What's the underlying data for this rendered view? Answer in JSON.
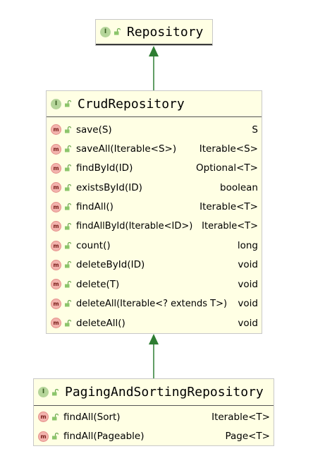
{
  "colors": {
    "box_fill": "#ffffe4",
    "box_border": "#c8c8c8",
    "arrow": "#2e7d32",
    "interface_badge": "#b5d59a",
    "method_badge": "#f2b3ad"
  },
  "badges": {
    "interface": "I",
    "method": "m"
  },
  "icons": {
    "visibility": "open-lock-icon"
  },
  "repository": {
    "name": "Repository"
  },
  "crud_repository": {
    "name": "CrudRepository",
    "methods": [
      {
        "name": "save(S)",
        "return_type": "S"
      },
      {
        "name": "saveAll(Iterable<S>)",
        "return_type": "Iterable<S>"
      },
      {
        "name": "findById(ID)",
        "return_type": "Optional<T>"
      },
      {
        "name": "existsById(ID)",
        "return_type": "boolean"
      },
      {
        "name": "findAll()",
        "return_type": "Iterable<T>"
      },
      {
        "name": "findAllById(Iterable<ID>)",
        "return_type": "Iterable<T>"
      },
      {
        "name": "count()",
        "return_type": "long"
      },
      {
        "name": "deleteById(ID)",
        "return_type": "void"
      },
      {
        "name": "delete(T)",
        "return_type": "void"
      },
      {
        "name": "deleteAll(Iterable<? extends T>)",
        "return_type": "void"
      },
      {
        "name": "deleteAll()",
        "return_type": "void"
      }
    ]
  },
  "paging_repository": {
    "name": "PagingAndSortingRepository",
    "methods": [
      {
        "name": "findAll(Sort)",
        "return_type": "Iterable<T>"
      },
      {
        "name": "findAll(Pageable)",
        "return_type": "Page<T>"
      }
    ]
  }
}
